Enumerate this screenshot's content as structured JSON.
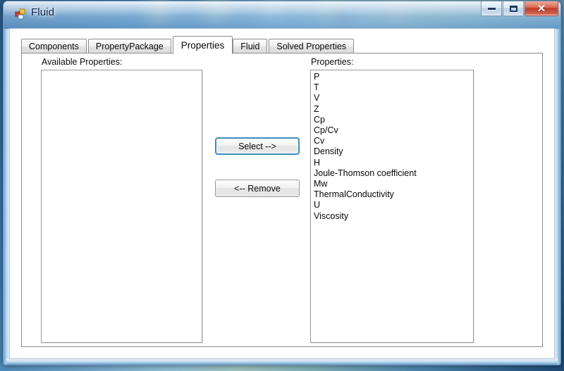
{
  "window": {
    "title": "Fluid",
    "icon": "form-icon",
    "controls": {
      "minimize_label": "–",
      "maximize_label": "□",
      "close_label": "✕"
    }
  },
  "tabs": [
    {
      "label": "Components",
      "selected": false
    },
    {
      "label": "PropertyPackage",
      "selected": false
    },
    {
      "label": "Properties",
      "selected": true
    },
    {
      "label": "Fluid",
      "selected": false
    },
    {
      "label": "Solved Properties",
      "selected": false
    }
  ],
  "panel": {
    "available": {
      "label": "Available Properties:",
      "items": []
    },
    "selected": {
      "label": "Properties:",
      "items": [
        "P",
        "T",
        "V",
        "Z",
        "Cp",
        "Cp/Cv",
        "Cv",
        "Density",
        "H",
        "Joule-Thomson coefficient",
        "Mw",
        "ThermalConductivity",
        "U",
        "Viscosity"
      ]
    },
    "buttons": {
      "select": "Select -->",
      "remove": "<-- Remove"
    }
  },
  "colors": {
    "accent_focus_border": "#3c8dbc",
    "close_button": "#c0392a",
    "caption_text": "#13294b",
    "tab_border": "#8d8d8d",
    "listbox_border": "#9a9a9a"
  }
}
